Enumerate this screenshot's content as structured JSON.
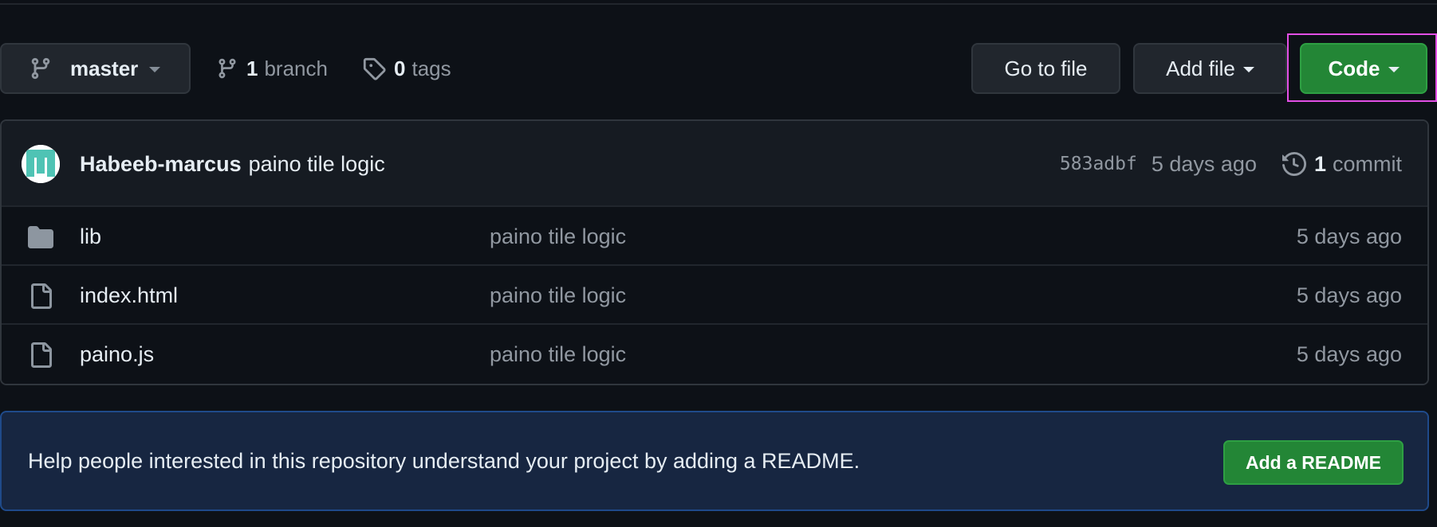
{
  "toolbar": {
    "branch_name": "master",
    "branch_count": "1",
    "branch_label": "branch",
    "tag_count": "0",
    "tag_label": "tags",
    "goto_file": "Go to file",
    "add_file": "Add file",
    "code": "Code"
  },
  "commit": {
    "author": "Habeeb-marcus",
    "message": "paino tile logic",
    "sha": "583adbf",
    "age": "5 days ago",
    "commit_count": "1",
    "commit_label": "commit"
  },
  "files": [
    {
      "name": "lib",
      "type": "folder",
      "message": "paino tile logic",
      "age": "5 days ago"
    },
    {
      "name": "index.html",
      "type": "file",
      "message": "paino tile logic",
      "age": "5 days ago"
    },
    {
      "name": "paino.js",
      "type": "file",
      "message": "paino tile logic",
      "age": "5 days ago"
    }
  ],
  "readme": {
    "text": "Help people interested in this repository understand your project by adding a README.",
    "button": "Add a README"
  },
  "colors": {
    "background": "#0d1117",
    "code_button": "#238636",
    "highlight": "#e34fe6",
    "banner": "#172641"
  }
}
